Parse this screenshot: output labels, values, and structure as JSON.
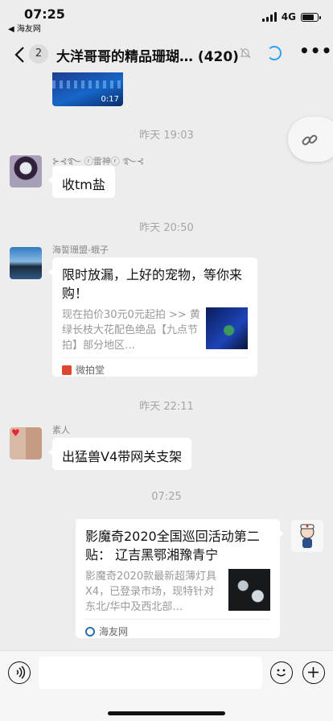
{
  "status_bar": {
    "time": "07:25",
    "back_app": "◀ 海友网",
    "network": "4G"
  },
  "nav": {
    "unread_count": "2",
    "title": "大洋哥哥的精品珊瑚…",
    "member_count": "(420)"
  },
  "video": {
    "duration": "0:17"
  },
  "messages": [
    {
      "time_label": "昨天 19:03",
      "sender": "⊱⊰࿐ ⓡ雷神ⓡ ࿐⊰",
      "text": "收tm盐"
    },
    {
      "time_label": "昨天 20:50",
      "sender": "海誓珊盟-蛾子",
      "card": {
        "title": "限时放漏，上好的宠物，等你来购！",
        "desc": "现在拍价30元0元起拍 >> 黄绿长枝大花配色绝品【九点节拍】部分地区…",
        "source": "微拍堂"
      }
    },
    {
      "time_label": "昨天 22:11",
      "sender": "素人",
      "text": "出猛兽V4带网关支架"
    },
    {
      "time_label": "07:25",
      "card": {
        "title": "影魔奇2020全国巡回活动第二贴： 辽吉黑鄂湘豫青宁",
        "desc": "影魔奇2020款最新超薄灯具X4，已登录市场，现特针对东北/华中及西北部…",
        "source": "海友网"
      }
    }
  ]
}
